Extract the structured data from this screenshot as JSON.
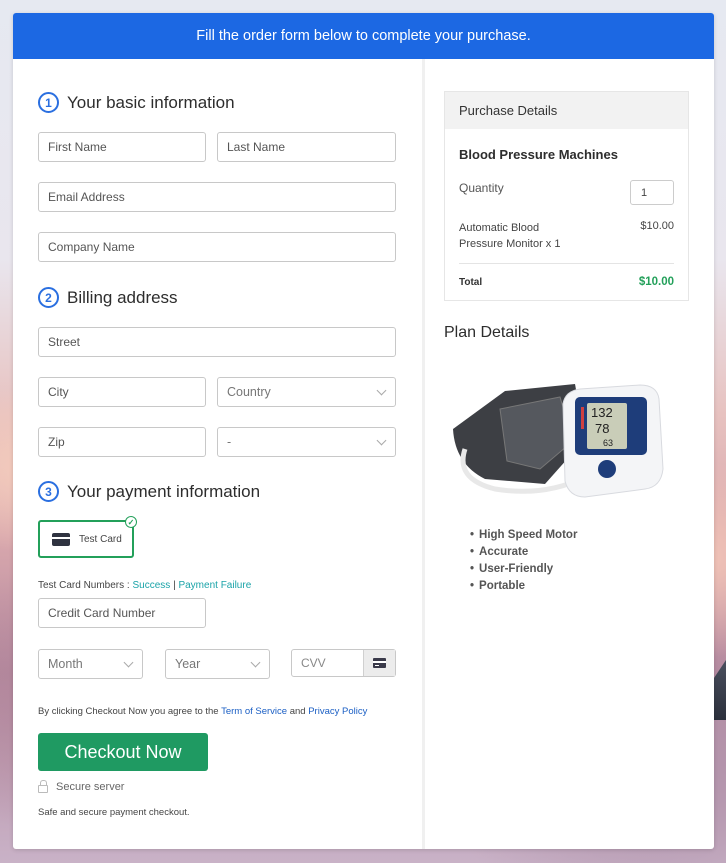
{
  "banner": {
    "text": "Fill the order form below to complete your purchase."
  },
  "sections": {
    "basic": {
      "number": "1",
      "title": "Your basic information"
    },
    "billing": {
      "number": "2",
      "title": "Billing address"
    },
    "payment": {
      "number": "3",
      "title": "Your payment information"
    }
  },
  "fields": {
    "first_name": {
      "placeholder": "First Name",
      "value": ""
    },
    "last_name": {
      "placeholder": "Last Name",
      "value": ""
    },
    "email": {
      "placeholder": "Email Address",
      "value": ""
    },
    "company": {
      "placeholder": "Company Name",
      "value": ""
    },
    "street": {
      "placeholder": "Street",
      "value": ""
    },
    "city": {
      "placeholder": "City",
      "value": ""
    },
    "country": {
      "selected": "Country"
    },
    "zip": {
      "placeholder": "Zip",
      "value": ""
    },
    "state": {
      "selected": "-"
    },
    "card_number": {
      "placeholder": "Credit Card Number",
      "value": ""
    },
    "month": {
      "selected": "Month"
    },
    "year": {
      "selected": "Year"
    },
    "cvv": {
      "placeholder": "CVV",
      "value": ""
    }
  },
  "payment": {
    "method_label": "Test Card",
    "test_numbers_label": "Test Card Numbers :",
    "success_link": "Success",
    "separator": "|",
    "failure_link": "Payment Failure"
  },
  "terms": {
    "prefix": "By clicking Checkout Now you agree to the",
    "tos_link": "Term of Service",
    "and": "and",
    "privacy_link": "Privacy Policy"
  },
  "checkout": {
    "button_label": "Checkout Now",
    "secure_label": "Secure server",
    "safe_text": "Safe and secure payment checkout."
  },
  "purchase": {
    "heading": "Purchase Details",
    "product": "Blood Pressure Machines",
    "quantity_label": "Quantity",
    "quantity": "1",
    "item_name": "Automatic Blood Pressure Monitor x 1",
    "item_price": "$10.00",
    "total_label": "Total",
    "total_value": "$10.00"
  },
  "plan": {
    "heading": "Plan Details",
    "image_alt": "Blood pressure monitor with cuff",
    "monitor_readings": [
      "132",
      "78",
      "63"
    ],
    "features": [
      "High Speed Motor",
      "Accurate",
      "User-Friendly",
      "Portable"
    ]
  },
  "colors": {
    "banner": "#1c68e3",
    "accent_blue": "#2a6fe0",
    "success_green": "#1f9a62",
    "link_teal": "#1aa3a8",
    "link_blue": "#1b5fc4"
  }
}
